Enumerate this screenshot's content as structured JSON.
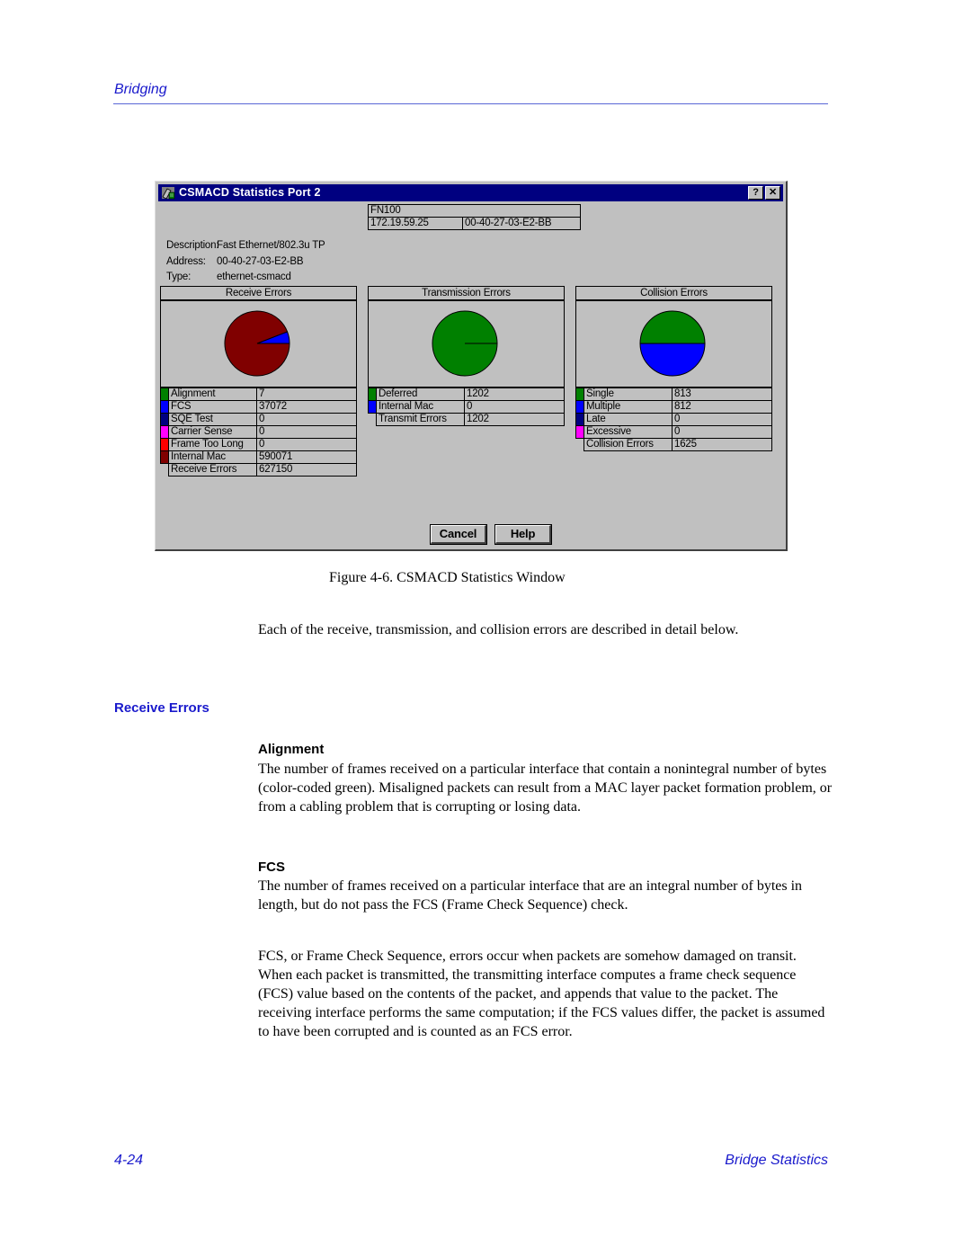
{
  "page": {
    "header_title": "Bridging",
    "footer_page": "4-24",
    "footer_section": "Bridge Statistics",
    "figure_caption": "Figure 4-6.  CSMACD Statistics Window",
    "intro_paragraph": "Each of the receive, transmission, and collision errors are described in detail below.",
    "section_heading": "Receive Errors",
    "subsections": [
      {
        "heading": "Alignment",
        "paragraphs": [
          "The number of frames received on a particular interface that contain a nonintegral number of bytes (color-coded green). Misaligned packets can result from a MAC layer packet formation problem, or from a cabling problem that is corrupting or losing data."
        ]
      },
      {
        "heading": "FCS",
        "paragraphs": [
          "The number of frames received on a particular interface that are an integral number of bytes in length, but do not pass the FCS (Frame Check Sequence) check.",
          "FCS, or Frame Check Sequence, errors occur when packets are somehow damaged on transit. When each packet is transmitted, the transmitting interface computes a frame check sequence (FCS) value based on the contents of the packet, and appends that value to the packet. The receiving interface performs the same computation; if the FCS values differ, the packet is assumed to have been corrupted and is counted as an FCS error."
        ]
      }
    ]
  },
  "window": {
    "title": "CSMACD Statistics Port 2",
    "app_icon": "stats-app-icon",
    "help_button": "?",
    "close_button": "✕",
    "device": {
      "name": "FN100",
      "ip": "172.19.59.25",
      "mac": "00-40-27-03-E2-BB"
    },
    "info": [
      {
        "key": "Description:",
        "value": "Fast Ethernet/802.3u TP"
      },
      {
        "key": "Address:",
        "value": "00-40-27-03-E2-BB"
      },
      {
        "key": "Type:",
        "value": "ethernet-csmacd"
      }
    ],
    "buttons": {
      "cancel": "Cancel",
      "help": "Help"
    }
  },
  "chart_data": [
    {
      "type": "pie",
      "title": "Receive Errors",
      "categories": [
        "Alignment",
        "FCS",
        "SQE Test",
        "Carrier Sense",
        "Frame Too Long",
        "Internal Mac"
      ],
      "values": [
        7,
        37072,
        0,
        0,
        0,
        590071
      ],
      "colors": [
        "#008000",
        "#0000ff",
        "#000080",
        "#ff00ff",
        "#ff0000",
        "#800000"
      ],
      "total_label": "Receive Errors",
      "total": 627150
    },
    {
      "type": "pie",
      "title": "Transmission Errors",
      "categories": [
        "Deferred",
        "Internal Mac"
      ],
      "values": [
        1202,
        0
      ],
      "colors": [
        "#008000",
        "#0000ff"
      ],
      "total_label": "Transmit Errors",
      "total": 1202
    },
    {
      "type": "pie",
      "title": "Collision Errors",
      "categories": [
        "Single",
        "Multiple",
        "Late",
        "Excessive"
      ],
      "values": [
        813,
        812,
        0,
        0
      ],
      "colors": [
        "#008000",
        "#0000ff",
        "#000080",
        "#ff00ff"
      ],
      "total_label": "Collision Errors",
      "total": 1625
    }
  ]
}
